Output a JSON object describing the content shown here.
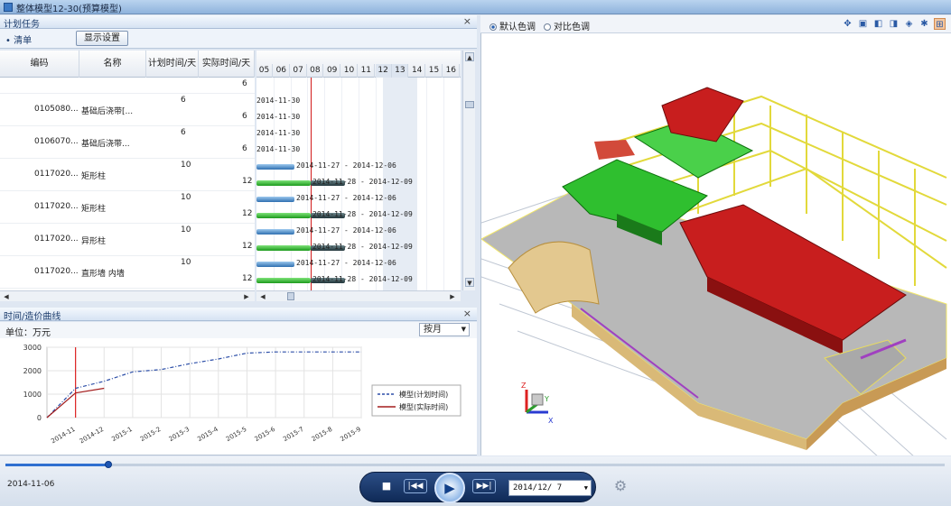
{
  "window": {
    "title": "整体模型12-30(预算模型)"
  },
  "task_panel": {
    "title": "计划任务",
    "list_tab": "清单",
    "display_settings_button": "显示设置",
    "columns": [
      "编码",
      "名称",
      "计划时间/天",
      "实际时间/天"
    ],
    "rows": [
      {
        "code": "",
        "name": "",
        "plan": "6",
        "actual": "6",
        "plan_bar_text": "2014-11-30",
        "act_bar_text": "",
        "clip": true
      },
      {
        "code": "0105080...",
        "name": "基础后浇带[...",
        "plan": "6",
        "actual": "6",
        "plan_bar_text": "2014-11-30",
        "act_bar_text": "2014-11-30"
      },
      {
        "code": "0106070...",
        "name": "基础后浇带...",
        "plan": "6",
        "actual": "6",
        "plan_bar_text": "2014-11-30",
        "act_bar_text": "2014-11-30"
      },
      {
        "code": "0117020...",
        "name": "矩形柱",
        "plan": "10",
        "actual": "12",
        "plan_bar_text": "2014-11-27 - 2014-12-06",
        "act_bar_text": "2014-11-28 - 2014-12-09"
      },
      {
        "code": "0117020...",
        "name": "矩形柱",
        "plan": "10",
        "actual": "12",
        "plan_bar_text": "2014-11-27 - 2014-12-06",
        "act_bar_text": "2014-11-28 - 2014-12-09"
      },
      {
        "code": "0117020...",
        "name": "异形柱",
        "plan": "10",
        "actual": "12",
        "plan_bar_text": "2014-11-27 - 2014-12-06",
        "act_bar_text": "2014-11-28 - 2014-12-09"
      },
      {
        "code": "0117020...",
        "name": "直形墙 内墙",
        "plan": "10",
        "actual": "12",
        "plan_bar_text": "2014-11-27 - 2014-12-06",
        "act_bar_text": "2014-11-28 - 2014-12-09"
      }
    ],
    "first_row_code": "0105080...",
    "first_row_name": "基础后浇带[...",
    "gantt_days": [
      "05",
      "06",
      "07",
      "08",
      "09",
      "10",
      "11",
      "12",
      "13",
      "14",
      "15",
      "16"
    ]
  },
  "curve_panel": {
    "title": "时间/造价曲线",
    "unit_label": "单位：万元",
    "period_select": "按月",
    "chart_data": {
      "type": "line",
      "x": [
        "2014-11",
        "2014-12",
        "2015-1",
        "2015-2",
        "2015-3",
        "2015-4",
        "2015-5",
        "2015-6",
        "2015-7",
        "2015-8",
        "2015-9"
      ],
      "ylim": [
        0,
        3000
      ],
      "yticks": [
        0,
        1000,
        2000,
        3000
      ],
      "series": [
        {
          "name": "模型(计划时间)",
          "color": "#2d4fa8",
          "dash": true,
          "points": [
            [
              -1,
              0
            ],
            [
              0,
              1250
            ],
            [
              1,
              1550
            ],
            [
              2,
              1950
            ],
            [
              3,
              2050
            ],
            [
              4,
              2300
            ],
            [
              5,
              2500
            ],
            [
              6,
              2750
            ],
            [
              7,
              2800
            ],
            [
              8,
              2800
            ],
            [
              9,
              2800
            ],
            [
              10,
              2800
            ]
          ]
        },
        {
          "name": "模型(实际时间)",
          "color": "#a31d1d",
          "dash": false,
          "points": [
            [
              -1,
              0
            ],
            [
              0,
              1050
            ],
            [
              1,
              1250
            ]
          ]
        }
      ],
      "marker_x": 0,
      "legend": "right"
    }
  },
  "view_panel": {
    "default_color": "默认色调",
    "compare_color": "对比色调"
  },
  "player": {
    "current_date": "2014-11-06",
    "date_input": "2014/12/ 7",
    "progress_fraction": 0.11
  },
  "colors": {
    "accent": "#2f6fd0",
    "today_line": "#d21a1a"
  }
}
